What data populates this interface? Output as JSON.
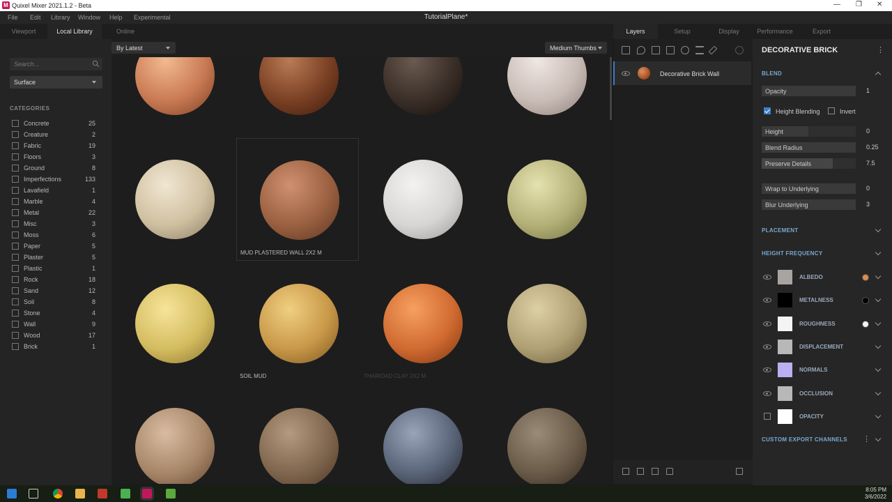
{
  "window": {
    "title": "Quixel Mixer 2021.1.2 - Beta",
    "project": "TutorialPlane*"
  },
  "menu": [
    "File",
    "Edit",
    "Library",
    "Window",
    "Help",
    "Experimental"
  ],
  "left_tabs": [
    "Viewport",
    "Local Library",
    "Online"
  ],
  "right_tabs": [
    "Layers",
    "Setup",
    "Display",
    "Performance",
    "Export"
  ],
  "sidebar": {
    "search_placeholder": "Search...",
    "type_select": "Surface",
    "categories_heading": "CATEGORIES",
    "categories": [
      {
        "name": "Concrete",
        "count": "25"
      },
      {
        "name": "Creature",
        "count": "2"
      },
      {
        "name": "Fabric",
        "count": "19"
      },
      {
        "name": "Floors",
        "count": "3"
      },
      {
        "name": "Ground",
        "count": "8"
      },
      {
        "name": "Imperfections",
        "count": "133"
      },
      {
        "name": "Lavafield",
        "count": "1"
      },
      {
        "name": "Marble",
        "count": "4"
      },
      {
        "name": "Metal",
        "count": "22"
      },
      {
        "name": "Misc",
        "count": "3"
      },
      {
        "name": "Moss",
        "count": "6"
      },
      {
        "name": "Paper",
        "count": "5"
      },
      {
        "name": "Plaster",
        "count": "5"
      },
      {
        "name": "Plastic",
        "count": "1"
      },
      {
        "name": "Rock",
        "count": "18"
      },
      {
        "name": "Sand",
        "count": "12"
      },
      {
        "name": "Soil",
        "count": "8"
      },
      {
        "name": "Stone",
        "count": "4"
      },
      {
        "name": "Wall",
        "count": "9"
      },
      {
        "name": "Wood",
        "count": "17"
      },
      {
        "name": "Brick",
        "count": "1"
      }
    ]
  },
  "library": {
    "sort": "By Latest",
    "thumb_size": "Medium Thumbs",
    "labels": {
      "mud_plastered": "MUD PLASTERED WALL 2X2 M",
      "soil_mud": "SOIL MUD",
      "faded": "THAIROAD CLAY 2X2 M"
    }
  },
  "layers": {
    "items": [
      {
        "name": "Decorative Brick Wall"
      }
    ]
  },
  "props": {
    "title": "DECORATIVE BRICK",
    "blend": "BLEND",
    "opacity_label": "Opacity",
    "opacity": "1",
    "height_blending": "Height Blending",
    "invert": "Invert",
    "height_label": "Height",
    "height": "0",
    "blend_radius_label": "Blend Radius",
    "blend_radius": "0.25",
    "preserve_label": "Preserve Details",
    "preserve": "7.5",
    "wrap_label": "Wrap to Underlying",
    "wrap": "0",
    "blur_label": "Blur Underlying",
    "blur": "3",
    "placement": "PLACEMENT",
    "height_freq": "HEIGHT FREQUENCY",
    "channels": [
      {
        "name": "ALBEDO"
      },
      {
        "name": "METALNESS"
      },
      {
        "name": "ROUGHNESS"
      },
      {
        "name": "DISPLACEMENT"
      },
      {
        "name": "NORMALS"
      },
      {
        "name": "OCCLUSION"
      },
      {
        "name": "OPACITY"
      }
    ],
    "custom_export": "CUSTOM EXPORT CHANNELS"
  },
  "taskbar": {
    "time": "8:05 PM",
    "date": "3/6/2022"
  }
}
